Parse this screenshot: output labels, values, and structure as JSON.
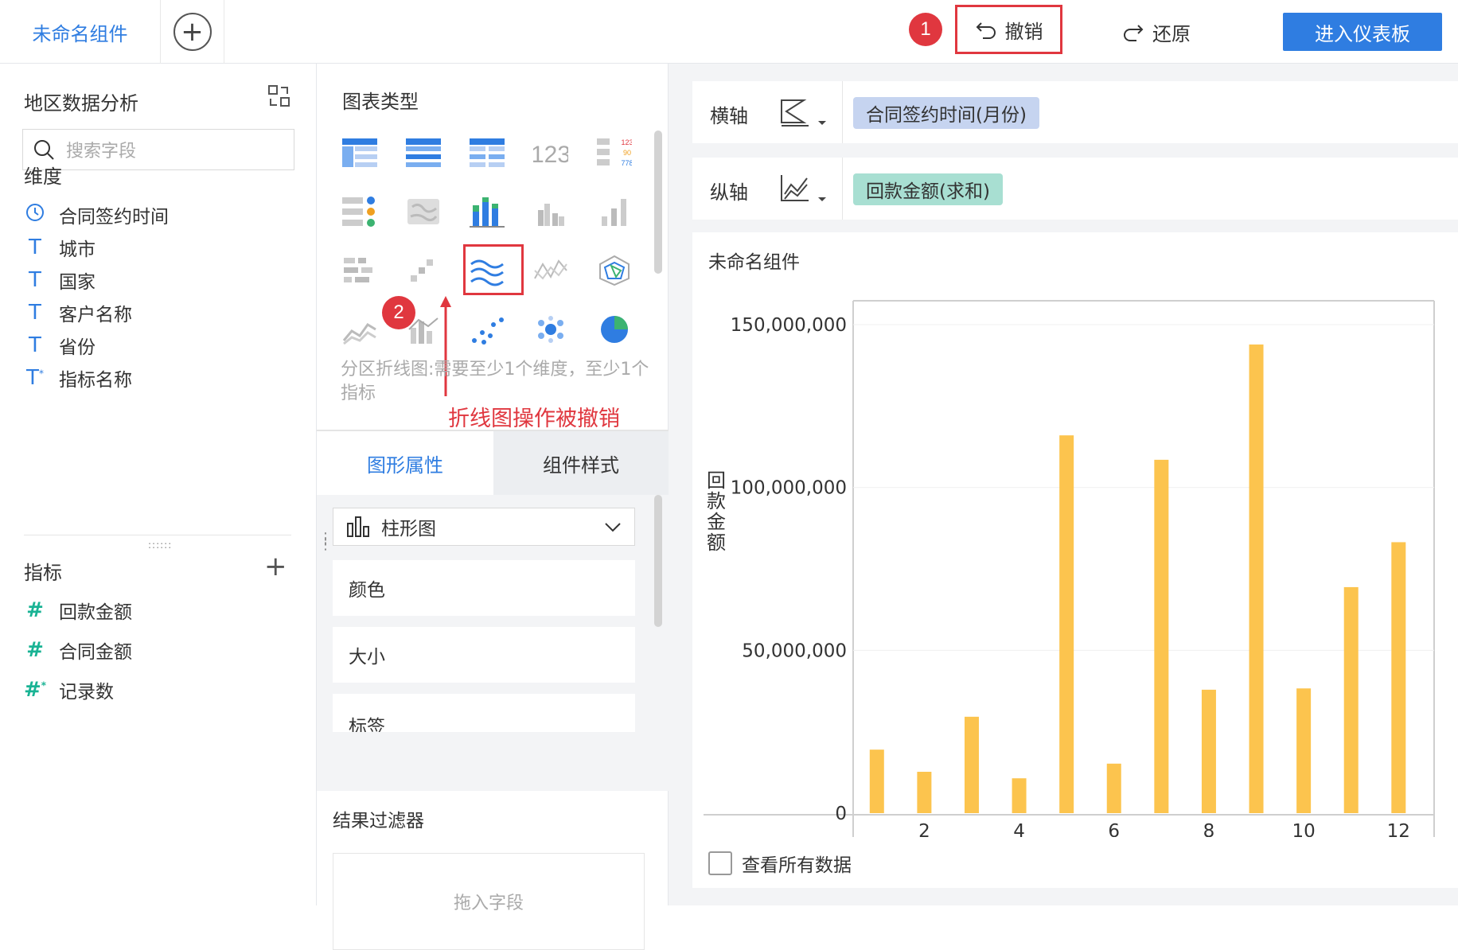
{
  "topbar": {
    "tab_active": "未命名组件",
    "undo": "撤销",
    "redo": "还原",
    "enter_dashboard": "进入仪表板",
    "badge_1": "1"
  },
  "left": {
    "title": "地区数据分析",
    "search_placeholder": "搜索字段",
    "dimensions_label": "维度",
    "dimensions": [
      "合同签约时间",
      "城市",
      "国家",
      "客户名称",
      "省份",
      "指标名称"
    ],
    "metrics_label": "指标",
    "metrics": [
      "回款金额",
      "合同金额",
      "记录数"
    ]
  },
  "middle": {
    "chart_types_label": "图表类型",
    "hint": "分区折线图:需要至少1个维度，至少1个指标",
    "note": "折线图操作被撤销",
    "badge_2": "2",
    "tab_graph_props": "图形属性",
    "tab_component_style": "组件样式",
    "chart_select": "柱形图",
    "props": [
      "颜色",
      "大小",
      "标签"
    ],
    "filter_title": "结果过滤器",
    "drop_hint": "拖入字段"
  },
  "right": {
    "x_axis_label": "横轴",
    "y_axis_label": "纵轴",
    "x_field": "合同签约时间(月份)",
    "y_field": "回款金额(求和)",
    "chart_title": "未命名组件",
    "view_all": "查看所有数据"
  },
  "colors": {
    "accent": "#2f7de1",
    "danger": "#e0373f",
    "bar": "#fcc44e",
    "x_pill": "#c6d4f0",
    "y_pill": "#a8dfd2"
  },
  "chart_data": {
    "type": "bar",
    "x": [
      1,
      2,
      3,
      4,
      5,
      6,
      7,
      8,
      9,
      10,
      11,
      12
    ],
    "x_ticks": [
      2,
      4,
      6,
      8,
      10,
      12
    ],
    "values": [
      19500000,
      12700000,
      29600000,
      10700000,
      116000000,
      15200000,
      108500000,
      37900000,
      143900000,
      38300000,
      69400000,
      83200000
    ],
    "y_ticks": [
      "0",
      "50,000,000",
      "100,000,000",
      "150,000,000"
    ],
    "ylim": [
      0,
      150000000
    ],
    "xlabel": "合同签约时间",
    "ylabel": "回款金额"
  }
}
